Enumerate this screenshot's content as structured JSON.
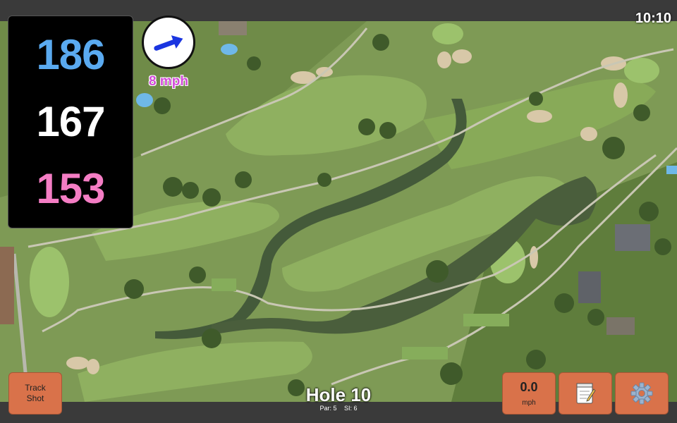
{
  "status": {
    "time": "10:10"
  },
  "distances": {
    "back": "186",
    "middle": "167",
    "front": "153"
  },
  "wind": {
    "speed": "8 mph",
    "direction_icon": "arrow-icon"
  },
  "hole": {
    "title": "Hole 10",
    "par": "Par: 5",
    "si": "SI: 6"
  },
  "buttons": {
    "track_shot": "Track\nShot",
    "speed_value": "0.0",
    "speed_unit": "mph",
    "notes_icon": "notepad-icon",
    "settings_icon": "gear-icon"
  },
  "colors": {
    "back": "#5aaaf0",
    "middle": "#ffffff",
    "front": "#f47dc4",
    "button": "#d9724a",
    "wind_text": "#d24bd9"
  }
}
